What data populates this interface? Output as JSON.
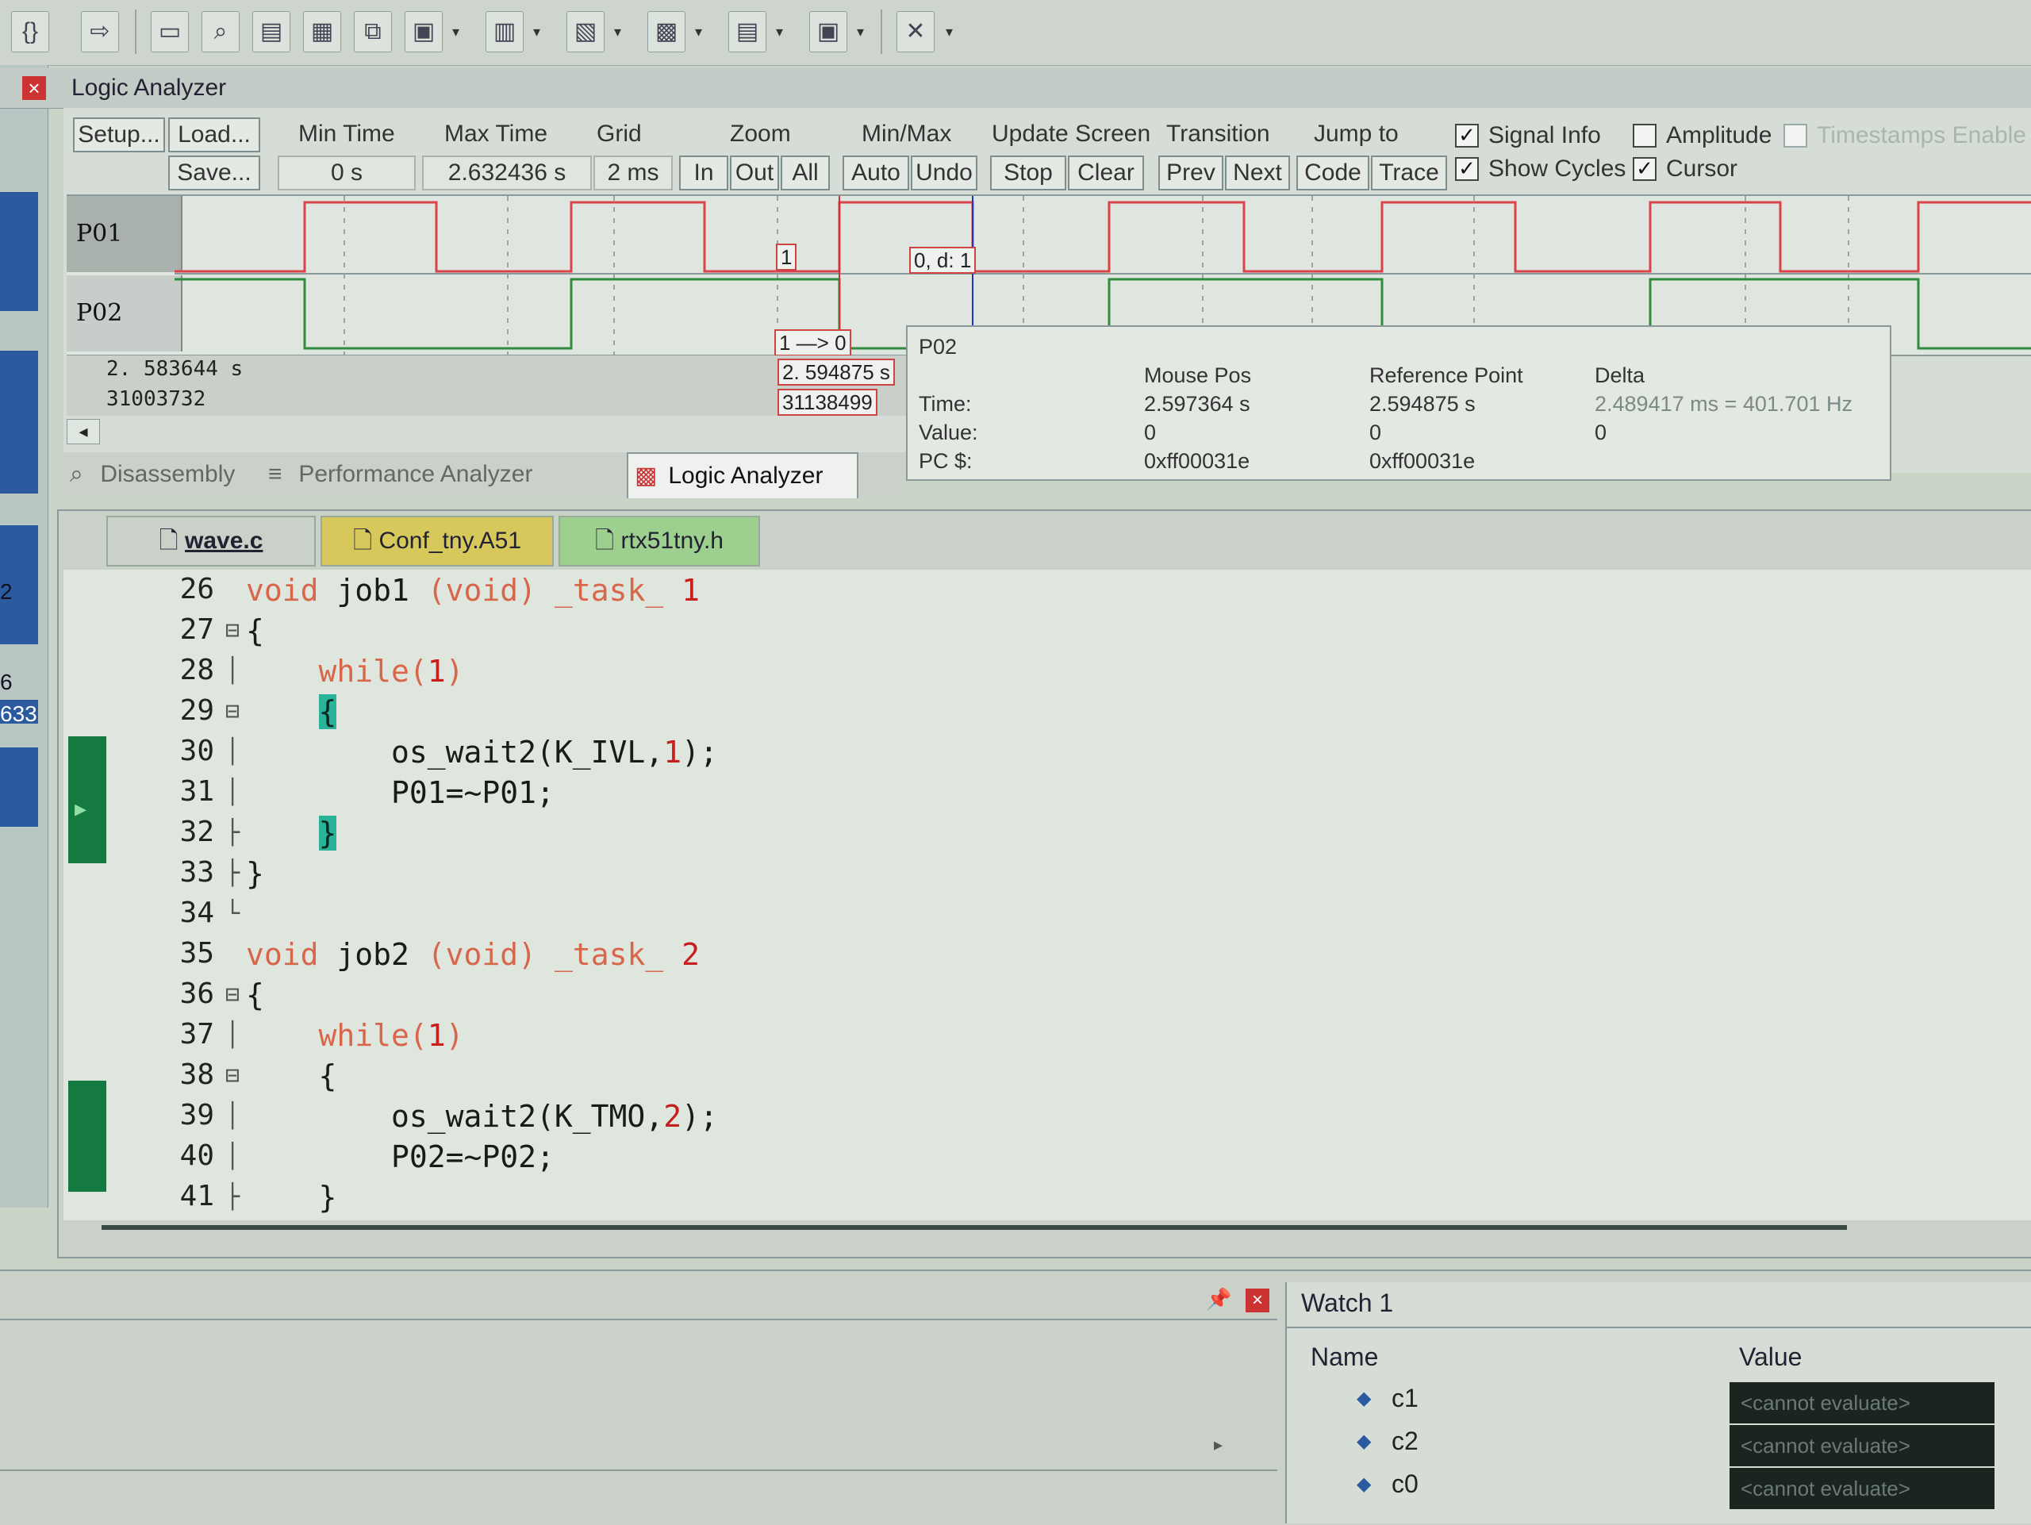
{
  "toolbar": {
    "icons": [
      "braces-icon",
      "arrow-right-icon",
      "window-icon",
      "find-icon",
      "source-icon",
      "memory-icon",
      "serial-icon",
      "analysis-icon",
      "watch-icon",
      "trace-icon",
      "logic-analyzer-icon",
      "toolbox-icon",
      "system-viewer-icon",
      "settings-icon"
    ]
  },
  "logic_analyzer": {
    "title": "Logic Analyzer",
    "buttons": {
      "setup": "Setup...",
      "load": "Load...",
      "save": "Save...",
      "zoom_in": "In",
      "zoom_out": "Out",
      "zoom_all": "All",
      "auto": "Auto",
      "undo": "Undo",
      "stop": "Stop",
      "clear": "Clear",
      "prev": "Prev",
      "next": "Next",
      "code": "Code",
      "trace": "Trace"
    },
    "labels": {
      "min_time": "Min Time",
      "max_time": "Max Time",
      "grid": "Grid",
      "zoom": "Zoom",
      "min_max": "Min/Max",
      "update_screen": "Update Screen",
      "transition": "Transition",
      "jump_to": "Jump to"
    },
    "values": {
      "min_time": "0 s",
      "max_time": "2.632436 s",
      "grid": "2 ms"
    },
    "options": [
      {
        "label": "Signal Info",
        "checked": true
      },
      {
        "label": "Amplitude",
        "checked": false
      },
      {
        "label": "Timestamps Enable",
        "checked": false
      },
      {
        "label": "Show Cycles",
        "checked": true
      },
      {
        "label": "Cursor",
        "checked": true
      }
    ],
    "signals": [
      {
        "name": "P01",
        "color": "#d9434a"
      },
      {
        "name": "P02",
        "color": "#2f8c3e"
      }
    ],
    "row_info": {
      "time": "2. 583644  s",
      "cycles": "31003732"
    },
    "markers": {
      "m1": "1",
      "m2": "0,    d:  1",
      "transition": "1  —>  0",
      "ref_time": "2. 594875  s",
      "ref_cycles": "31138499"
    },
    "tooltip": {
      "signal": "P02",
      "headers": {
        "mouse": "Mouse Pos",
        "ref": "Reference Point",
        "delta": "Delta"
      },
      "rows": [
        {
          "label": "Time:",
          "mouse": "2.597364 s",
          "ref": "2.594875 s",
          "delta": "2.489417 ms = 401.701 Hz"
        },
        {
          "label": "Value:",
          "mouse": "0",
          "ref": "0",
          "delta": "0"
        },
        {
          "label": "PC $:",
          "mouse": "0xff00031e",
          "ref": "0xff00031e",
          "delta": ""
        }
      ]
    }
  },
  "panel_tabs": [
    {
      "label": "Disassembly",
      "active": false
    },
    {
      "label": "Performance Analyzer",
      "active": false
    },
    {
      "label": "Logic Analyzer",
      "active": true
    }
  ],
  "file_tabs": [
    {
      "label": "wave.c",
      "active": true
    },
    {
      "label": "Conf_tny.A51",
      "active": false
    },
    {
      "label": "rtx51tny.h",
      "active": false
    }
  ],
  "code_lines": [
    {
      "n": "26",
      "fold": "",
      "html": "<span class=\"kw\">void</span> job1 <span class=\"kw\">(void)</span> <span class=\"kw\">_task_</span> <span class=\"num\">1</span>"
    },
    {
      "n": "27",
      "fold": "⊟",
      "html": "{"
    },
    {
      "n": "28",
      "fold": "│",
      "html": "    <span class=\"kw\">while</span><span class=\"kw\">(</span><span class=\"num\">1</span><span class=\"kw\">)</span>"
    },
    {
      "n": "29",
      "fold": "⊟",
      "html": "    <span class=\"hl\">{</span>"
    },
    {
      "n": "30",
      "fold": "│",
      "html": "        os_wait2(K_IVL,<span class=\"num\">1</span>);"
    },
    {
      "n": "31",
      "fold": "│",
      "html": "        P01=~P01;"
    },
    {
      "n": "32",
      "fold": "├",
      "html": "    <span class=\"hl\">}</span>"
    },
    {
      "n": "33",
      "fold": "├",
      "html": "}"
    },
    {
      "n": "34",
      "fold": "└",
      "html": ""
    },
    {
      "n": "35",
      "fold": "",
      "html": "<span class=\"kw\">void</span> job2 <span class=\"kw\">(void)</span> <span class=\"kw\">_task_</span> <span class=\"num\">2</span>"
    },
    {
      "n": "36",
      "fold": "⊟",
      "html": "{"
    },
    {
      "n": "37",
      "fold": "│",
      "html": "    <span class=\"kw\">while</span><span class=\"kw\">(</span><span class=\"num\">1</span><span class=\"kw\">)</span>"
    },
    {
      "n": "38",
      "fold": "⊟",
      "html": "    {"
    },
    {
      "n": "39",
      "fold": "│",
      "html": "        os_wait2(K_TMO,<span class=\"num\">2</span>);"
    },
    {
      "n": "40",
      "fold": "│",
      "html": "        P02=~P02;"
    },
    {
      "n": "41",
      "fold": "├",
      "html": "    }"
    }
  ],
  "left_strip_labels": [
    "2",
    "6",
    "633"
  ],
  "watch": {
    "title": "Watch 1",
    "col_name": "Name",
    "col_value": "Value",
    "items": [
      {
        "name": "c1",
        "value": "<cannot evaluate>"
      },
      {
        "name": "c2",
        "value": "<cannot evaluate>"
      },
      {
        "name": "c0",
        "value": "<cannot evaluate>"
      }
    ]
  }
}
